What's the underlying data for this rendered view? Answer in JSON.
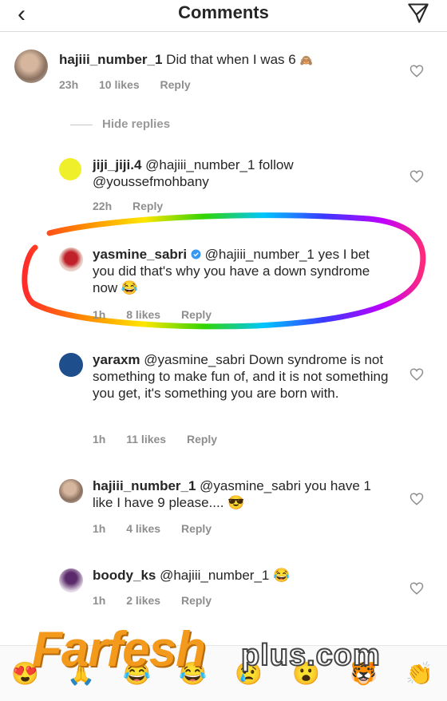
{
  "header": {
    "title": "Comments"
  },
  "hide_replies_label": "Hide replies",
  "comments": [
    {
      "username": "hajiii_number_1",
      "text": "Did that when I was 6",
      "emoji": "🙈",
      "time": "23h",
      "likes": "10 likes",
      "reply": "Reply"
    },
    {
      "username": "jiji_jiji.4",
      "mention": "@hajiii_number_1",
      "text": "follow @youssefmohbany",
      "time": "22h",
      "reply": "Reply"
    },
    {
      "username": "yasmine_sabri",
      "mention": "@hajiii_number_1",
      "text": "yes I bet you did that's why you have a down syndrome now",
      "emoji": "😂",
      "time": "1h",
      "likes": "8 likes",
      "reply": "Reply"
    },
    {
      "username": "yaraxm",
      "mention": "@yasmine_sabri",
      "text": "Down syndrome is not something to make fun of, and it is not something you get, it's something you are born with.",
      "time": "1h",
      "likes": "11 likes",
      "reply": "Reply"
    },
    {
      "username": "hajiii_number_1",
      "mention": "@yasmine_sabri",
      "text": "you have 1 like I have 9 please....",
      "emoji": "😎",
      "time": "1h",
      "likes": "4 likes",
      "reply": "Reply"
    },
    {
      "username": "boody_ks",
      "mention": "@hajiii_number_1",
      "emoji": "😂",
      "time": "1h",
      "likes": "2 likes",
      "reply": "Reply"
    }
  ],
  "emoji_bar": [
    "😍",
    "🙏",
    "😂",
    "😂",
    "😢",
    "😮",
    "🐯",
    "👏"
  ],
  "watermark": {
    "brand": "Farfesh",
    "suffix": "plus.com"
  },
  "colors": {
    "accent": "#f39a1d",
    "muted": "#8e8e8e",
    "verified": "#3897f0"
  },
  "icons": [
    "back-arrow-icon",
    "send-icon",
    "heart-icon",
    "verified-badge-icon"
  ]
}
